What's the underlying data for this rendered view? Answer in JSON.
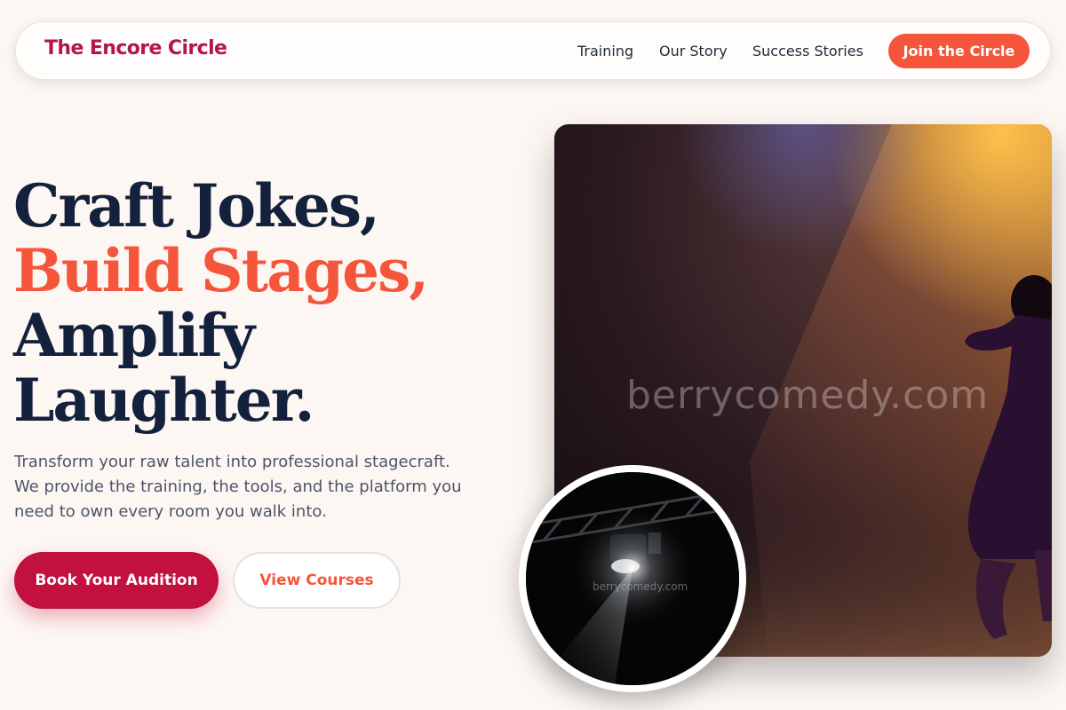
{
  "brand": {
    "name": "The Encore Circle"
  },
  "nav": {
    "links": [
      "Training",
      "Our Story",
      "Success Stories"
    ],
    "cta": "Join the Circle"
  },
  "hero": {
    "headline": {
      "line1": "Craft Jokes,",
      "line2": "Build Stages,",
      "line3": "Amplify",
      "line4": "Laughter."
    },
    "lede": "Transform your raw talent into professional stagecraft. We provide the training, the tools, and the platform you need to own every room you walk into.",
    "primary_cta": "Book Your Audition",
    "secondary_cta": "View Courses"
  },
  "images": {
    "main_watermark": "berrycomedy.com",
    "circle_watermark": "berrycomedy.com"
  },
  "colors": {
    "brand": "#b5164a",
    "accent": "#f5553a",
    "primary_button": "#c2103f",
    "headline": "#14213d",
    "background": "#fdf7f3"
  }
}
